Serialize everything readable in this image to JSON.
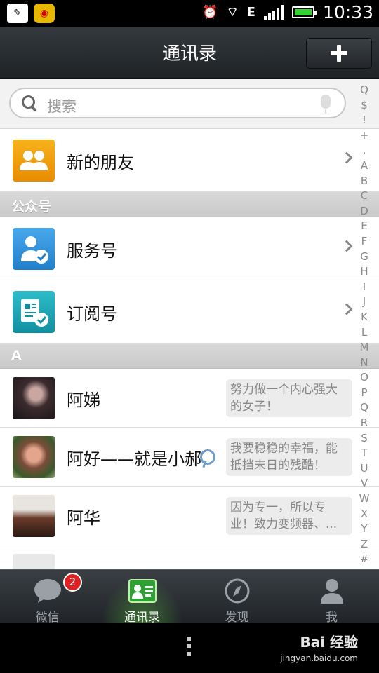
{
  "status_bar": {
    "time": "10:33",
    "network": "E"
  },
  "header": {
    "title": "通讯录"
  },
  "search": {
    "placeholder": "搜索"
  },
  "new_friends": {
    "label": "新的朋友"
  },
  "sections": {
    "public": "公众号",
    "a": "A"
  },
  "public_accounts": [
    {
      "label": "服务号"
    },
    {
      "label": "订阅号"
    }
  ],
  "contacts": [
    {
      "name": "阿娣",
      "signature": "努力做一个内心强大的女子！"
    },
    {
      "name": "阿好——就是小郝",
      "signature": "我要稳稳的幸福，能抵挡末日的残酷！"
    },
    {
      "name": "阿华",
      "signature": "因为专一，所以专业！致力变频器、..."
    }
  ],
  "index_letters": [
    "Q",
    "$",
    "!",
    "+",
    ",",
    "A",
    "B",
    "C",
    "D",
    "E",
    "F",
    "G",
    "H",
    "I",
    "J",
    "K",
    "L",
    "M",
    "N",
    "O",
    "P",
    "Q",
    "R",
    "S",
    "T",
    "U",
    "V",
    "W",
    "X",
    "Y",
    "Z",
    "#"
  ],
  "tabs": [
    {
      "label": "微信",
      "badge": "2"
    },
    {
      "label": "通讯录"
    },
    {
      "label": "发现"
    },
    {
      "label": "我"
    }
  ],
  "watermark": {
    "main": "Bai 经验",
    "sub": "jingyan.baidu.com"
  },
  "colors": {
    "active_tab_glow": "#5ac83c",
    "new_friend_icon": "#f0a000",
    "service_icon": "#2b8fd6",
    "subscribe_icon": "#1ba9b8",
    "badge": "#e02020"
  }
}
